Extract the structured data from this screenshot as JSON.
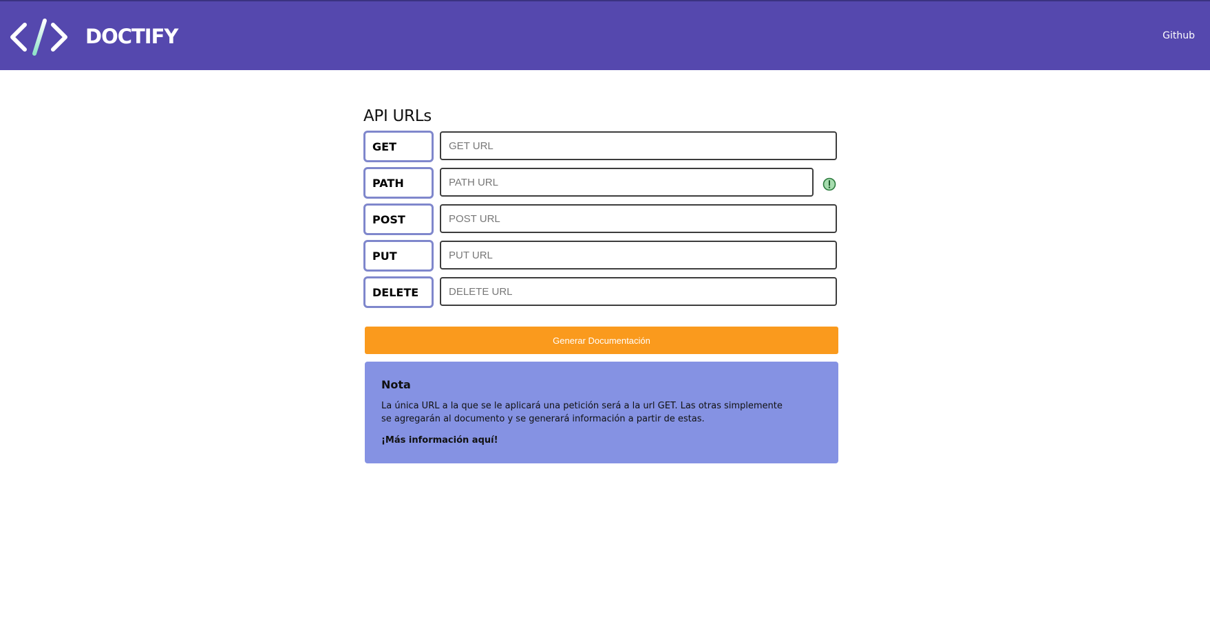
{
  "header": {
    "brand": "DOCTIFY",
    "logo_icon": "code-brackets-icon",
    "github_label": "Github",
    "bg_color": "#5548ae"
  },
  "main": {
    "title": "API URLs",
    "rows": [
      {
        "method": "GET",
        "placeholder": "GET URL",
        "value": ""
      },
      {
        "method": "PATH",
        "placeholder": "PATH URL",
        "value": "",
        "status_icon": "info-circle-icon"
      },
      {
        "method": "POST",
        "placeholder": "POST URL",
        "value": ""
      },
      {
        "method": "PUT",
        "placeholder": "PUT URL",
        "value": ""
      },
      {
        "method": "DELETE",
        "placeholder": "DELETE URL",
        "value": ""
      }
    ],
    "generate_label": "Generar Documentación",
    "generate_color": "#fa9a1d"
  },
  "note": {
    "title": "Nota",
    "text": "La única URL a la que se le aplicará una petición será a la url GET. Las otras simplemente se agregarán al documento y se generará información a partir de estas.",
    "link_label": "¡Más información aquí!",
    "bg_color": "#8592e3"
  }
}
